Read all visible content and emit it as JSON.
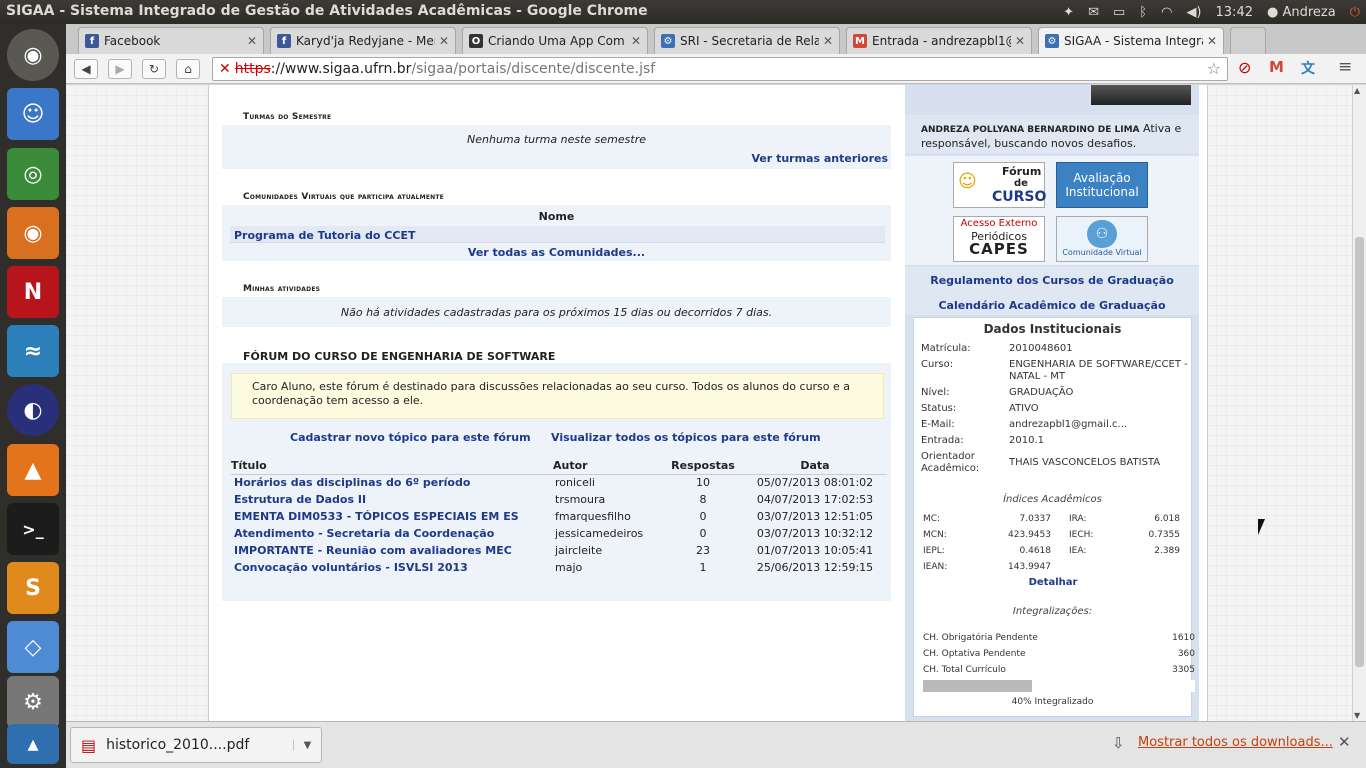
{
  "window_title": "SIGAA - Sistema Integrado de Gestão de Atividades Acadêmicas - Google Chrome",
  "panel": {
    "clock": "13:42",
    "user": "Andreza"
  },
  "launcher": [
    "ubuntu-icon",
    "files-icon",
    "chrome-icon",
    "firefox-icon",
    "netflix-icon",
    "workbench-icon",
    "eclipse-icon",
    "vlc-icon",
    "terminal-icon",
    "sublime-icon",
    "cube-icon",
    "settings-icon",
    "app-icon"
  ],
  "tabs": [
    {
      "title": "Facebook",
      "icon": "f",
      "color": "#3b5998"
    },
    {
      "title": "Karyd'ja Redyjane - Mensa",
      "icon": "f",
      "color": "#3b5998"
    },
    {
      "title": "Criando Uma App Com De",
      "icon": "O",
      "color": "#333333"
    },
    {
      "title": "SRI - Secretaria de Relaçõ",
      "icon": "⚙",
      "color": "#3b6fb6"
    },
    {
      "title": "Entrada - andrezapbl1@g",
      "icon": "M",
      "color": "#d14836"
    },
    {
      "title": "SIGAA - Sistema Integrado",
      "icon": "⚙",
      "color": "#3b6fb6"
    }
  ],
  "url": {
    "scheme": "https",
    "host": "://www.sigaa.ufrn.br",
    "path": "/sigaa/portais/discente/discente.jsf"
  },
  "turmas": {
    "title": "Turmas do Semestre",
    "empty": "Nenhuma turma neste semestre",
    "link": "Ver turmas anteriores"
  },
  "comunidades": {
    "title": "Comunidades Virtuais que participa atualmente",
    "col": "Nome",
    "item": "Programa de Tutoria do CCET",
    "link": "Ver todas as Comunidades..."
  },
  "atividades": {
    "title": "Minhas atividades",
    "empty": "Não há atividades cadastradas para os próximos 15 dias ou decorridos 7 dias."
  },
  "forum": {
    "title": "FÓRUM DO CURSO DE ENGENHARIA DE SOFTWARE",
    "notice": "Caro Aluno, este fórum é destinado para discussões relacionadas ao seu curso. Todos os alunos do curso e a coordenação tem acesso a ele.",
    "new_topic": "Cadastrar novo tópico para este fórum",
    "all_topics": "Visualizar todos os tópicos para este fórum",
    "headers": [
      "Título",
      "Autor",
      "Respostas",
      "Data"
    ],
    "rows": [
      {
        "title": "Horários das disciplinas do 6º período",
        "author": "roniceli",
        "replies": "10",
        "date": "05/07/2013 08:01:02"
      },
      {
        "title": "Estrutura de Dados II",
        "author": "trsmoura",
        "replies": "8",
        "date": "04/07/2013 17:02:53"
      },
      {
        "title": "EMENTA DIM0533 - TÓPICOS ESPECIAIS EM ES",
        "author": "fmarquesfilho",
        "replies": "0",
        "date": "03/07/2013 12:51:05"
      },
      {
        "title": "Atendimento - Secretaria da Coordenação",
        "author": "jessicamedeiros",
        "replies": "0",
        "date": "03/07/2013 10:32:12"
      },
      {
        "title": "IMPORTANTE - Reunião com avaliadores MEC",
        "author": "jaircleite",
        "replies": "23",
        "date": "01/07/2013 10:05:41"
      },
      {
        "title": "Convocação voluntários - ISVLSI 2013",
        "author": "majo",
        "replies": "1",
        "date": "25/06/2013 12:59:15"
      }
    ]
  },
  "profile": {
    "name": "ANDREZA POLLYANA BERNARDINO DE LIMA",
    "status_text": "Ativa e responsável, buscando novos desafios."
  },
  "badges": {
    "forum": [
      "Fórum",
      "de",
      "CURSO"
    ],
    "avaliacao": [
      "Avaliação",
      "Institucional"
    ],
    "periodicos": [
      "Acesso Externo",
      "Periódicos",
      "CAPES"
    ],
    "comunidade": "Comunidade Virtual"
  },
  "links": {
    "regulamento": "Regulamento dos Cursos de Graduação",
    "calendario": "Calendário Acadêmico de Graduação"
  },
  "dados": {
    "title": "Dados Institucionais",
    "fields": [
      {
        "label": "Matrícula:",
        "value": "2010048601"
      },
      {
        "label": "Curso:",
        "value": "ENGENHARIA DE SOFTWARE/CCET - NATAL - MT"
      },
      {
        "label": "Nível:",
        "value": "GRADUAÇÃO"
      },
      {
        "label": "Status:",
        "value": "ATIVO"
      },
      {
        "label": "E-Mail:",
        "value": "andrezapbl1@gmail.c..."
      },
      {
        "label": "Entrada:",
        "value": "2010.1"
      },
      {
        "label": "Orientador Acadêmico:",
        "value": "THAIS VASCONCELOS BATISTA"
      }
    ]
  },
  "indices": {
    "title": "Índices Acadêmicos",
    "rows": [
      [
        {
          "k": "MC:",
          "v": "7.0337"
        },
        {
          "k": "IRA:",
          "v": "6.018"
        }
      ],
      [
        {
          "k": "MCN:",
          "v": "423.9453"
        },
        {
          "k": "IECH:",
          "v": "0.7355"
        }
      ],
      [
        {
          "k": "IEPL:",
          "v": "0.4618"
        },
        {
          "k": "IEA:",
          "v": "2.389"
        }
      ],
      [
        {
          "k": "IEAN:",
          "v": "143.9947"
        },
        {
          "k": "",
          "v": ""
        }
      ]
    ],
    "detail": "Detalhar"
  },
  "integralizacoes": {
    "title": "Integralizações:",
    "rows": [
      {
        "label": "CH. Obrigatória Pendente",
        "value": "1610"
      },
      {
        "label": "CH. Optativa Pendente",
        "value": "360"
      },
      {
        "label": "CH. Total Currículo",
        "value": "3305"
      }
    ],
    "progress": 40,
    "progress_label": "40% Integralizado"
  },
  "downloads": {
    "file": "historico_2010....pdf",
    "show_all": "Mostrar todos os downloads..."
  }
}
